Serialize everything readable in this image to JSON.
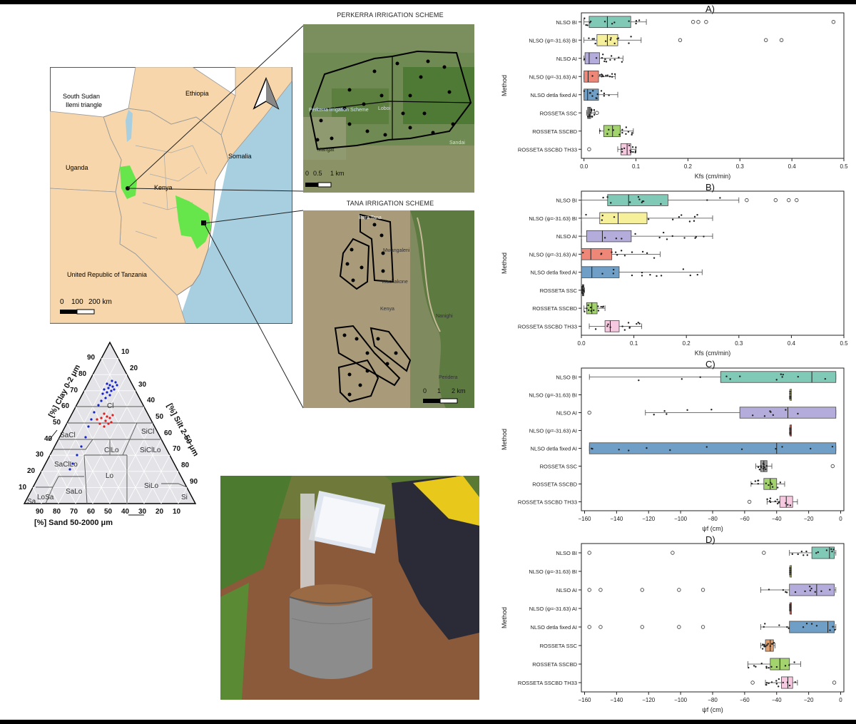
{
  "map": {
    "countries": [
      "South Sudan",
      "Ilemi triangle",
      "Ethiopia",
      "Uganda",
      "Kenya",
      "Somalia",
      "United Republic of Tanzania"
    ],
    "scale": [
      "0",
      "100",
      "200 km"
    ],
    "colors": {
      "land": "#f6d6aa",
      "scheme": "#66e64a",
      "sea": "#a8cfe0",
      "outside": "#ffffff"
    }
  },
  "insets": {
    "perkerra": {
      "title": "PERKERRA IRRIGATION SCHEME",
      "scale": [
        "0",
        "0.5",
        "1 km"
      ],
      "labels": [
        "Perkerra Irrigation Scheme",
        "Marigat",
        "Sandai",
        "Loboi"
      ]
    },
    "tana": {
      "title": "TANA IRRIGATION SCHEME",
      "scale": [
        "0",
        "1",
        "2 km"
      ],
      "labels": [
        "Bura Tana",
        "Mwangaleni",
        "Wachakone",
        "Kenya",
        "Nanighi",
        "Peridera"
      ]
    }
  },
  "triangle": {
    "left_axis": "[%] Clay 0-2 μm",
    "right_axis": "[%] Silt 2-50 μm",
    "bottom_axis": "[%] Sand 50-2000 μm",
    "ticks": [
      "10",
      "20",
      "30",
      "40",
      "50",
      "60",
      "70",
      "80",
      "90"
    ],
    "classes": [
      "Cl",
      "SaCl",
      "SiCl",
      "ClLo",
      "SiClLo",
      "SaClLo",
      "Lo",
      "SaLo",
      "SiLo",
      "LoSa",
      "Sa",
      "Si"
    ],
    "series_colors": {
      "blue": "#1522c9",
      "red": "#e01b1b"
    }
  },
  "chart_data": [
    {
      "type": "box",
      "title": "A)",
      "xlabel": "Kfs (cm/min)",
      "ylabel": "Method",
      "xlim": [
        -0.005,
        0.5
      ],
      "xticks": [
        0.0,
        0.1,
        0.2,
        0.3,
        0.4,
        0.5
      ],
      "xtick_labels": [
        "0.0",
        "0.1",
        "0.2",
        "0.3",
        "0.4",
        "0.5"
      ],
      "categories": [
        "NLSO BI",
        "NLSO  (ψ=-31.63) BI",
        "NLSO  AI",
        "NLSO  (ψ=-31.63) AI",
        "NLSO  detla fixed AI",
        "ROSSETA SSC",
        "ROSSETA SSCBD",
        "ROSSETA SSCBD TH33"
      ],
      "colors": [
        "#7fc9b6",
        "#f7f09a",
        "#b4addb",
        "#ee8777",
        "#6f9fc7",
        "#9a9a9a",
        "#a3d36c",
        "#f6c9e0"
      ],
      "boxes": [
        {
          "wlo": 0.0,
          "q1": 0.01,
          "med": 0.045,
          "q3": 0.09,
          "whi": 0.12,
          "out": [
            0.21,
            0.22,
            0.235,
            0.48
          ]
        },
        {
          "wlo": 0.0,
          "q1": 0.025,
          "med": 0.045,
          "q3": 0.065,
          "whi": 0.11,
          "out": [
            0.185,
            0.35,
            0.38
          ]
        },
        {
          "wlo": 0.0,
          "q1": 0.002,
          "med": 0.01,
          "q3": 0.03,
          "whi": 0.075,
          "out": []
        },
        {
          "wlo": 0.0,
          "q1": 0.0,
          "med": 0.008,
          "q3": 0.028,
          "whi": 0.06,
          "out": []
        },
        {
          "wlo": 0.0,
          "q1": 0.0,
          "med": 0.007,
          "q3": 0.028,
          "whi": 0.065,
          "out": []
        },
        {
          "wlo": 0.005,
          "q1": 0.007,
          "med": 0.01,
          "q3": 0.013,
          "whi": 0.02,
          "out": [
            0.025
          ]
        },
        {
          "wlo": 0.03,
          "q1": 0.038,
          "med": 0.055,
          "q3": 0.07,
          "whi": 0.095,
          "out": []
        },
        {
          "wlo": 0.065,
          "q1": 0.071,
          "med": 0.083,
          "q3": 0.09,
          "whi": 0.1,
          "out": [
            0.01
          ]
        }
      ]
    },
    {
      "type": "box",
      "title": "B)",
      "xlabel": "Kfs (cm/min)",
      "ylabel": "Method",
      "xlim": [
        0.0,
        0.5
      ],
      "xticks": [
        0.0,
        0.1,
        0.2,
        0.3,
        0.4,
        0.5
      ],
      "xtick_labels": [
        "0.0",
        "0.1",
        "0.2",
        "0.3",
        "0.4",
        "0.5"
      ],
      "categories": [
        "NLSO BI",
        "NLSO  (ψ=-31.63) BI",
        "NLSO  AI",
        "NLSO  (ψ=-31.63) AI",
        "NLSO  detla fixed AI",
        "ROSSETA SSC",
        "ROSSETA SSCBD",
        "ROSSETA SSCBD TH33"
      ],
      "colors": [
        "#7fc9b6",
        "#f7f09a",
        "#b4addb",
        "#ee8777",
        "#6f9fc7",
        "#9a9a9a",
        "#a3d36c",
        "#f6c9e0"
      ],
      "boxes": [
        {
          "wlo": 0.0,
          "q1": 0.05,
          "med": 0.09,
          "q3": 0.165,
          "whi": 0.3,
          "out": [
            0.315,
            0.37,
            0.395,
            0.41
          ]
        },
        {
          "wlo": 0.0,
          "q1": 0.035,
          "med": 0.07,
          "q3": 0.125,
          "whi": 0.25,
          "out": []
        },
        {
          "wlo": 0.0,
          "q1": 0.01,
          "med": 0.04,
          "q3": 0.095,
          "whi": 0.25,
          "out": []
        },
        {
          "wlo": 0.0,
          "q1": 0.0,
          "med": 0.018,
          "q3": 0.058,
          "whi": 0.15,
          "out": []
        },
        {
          "wlo": 0.0,
          "q1": 0.0,
          "med": 0.02,
          "q3": 0.072,
          "whi": 0.23,
          "out": []
        },
        {
          "wlo": 0.001,
          "q1": 0.002,
          "med": 0.003,
          "q3": 0.004,
          "whi": 0.006,
          "out": []
        },
        {
          "wlo": 0.005,
          "q1": 0.01,
          "med": 0.02,
          "q3": 0.03,
          "whi": 0.045,
          "out": []
        },
        {
          "wlo": 0.015,
          "q1": 0.045,
          "med": 0.055,
          "q3": 0.072,
          "whi": 0.115,
          "out": []
        }
      ]
    },
    {
      "type": "box",
      "title": "C)",
      "xlabel": "ψf (cm)",
      "ylabel": "Method",
      "xlim": [
        -162,
        2
      ],
      "xticks": [
        -160,
        -140,
        -120,
        -100,
        -80,
        -60,
        -40,
        -20,
        0
      ],
      "xtick_labels": [
        "−160",
        "−140",
        "−120",
        "−100",
        "−80",
        "−60",
        "−40",
        "−20",
        "0"
      ],
      "categories": [
        "NLSO BI",
        "NLSO  (ψ=-31.63) BI",
        "NLSO  AI",
        "NLSO  (ψ=-31.63) AI",
        "NLSO  detla fixed AI",
        "ROSSETA SSC",
        "ROSSETA SSCBD",
        "ROSSETA SSCBD TH33"
      ],
      "colors": [
        "#7fc9b6",
        "#f7f09a",
        "#b4addb",
        "#ee8777",
        "#6f9fc7",
        "#9a9a9a",
        "#a3d36c",
        "#f6c9e0"
      ],
      "boxes": [
        {
          "wlo": -157,
          "q1": -75,
          "med": -18,
          "q3": -3,
          "whi": -3,
          "out": []
        },
        {
          "wlo": -31.6,
          "q1": -31.6,
          "med": -31.6,
          "q3": -31.6,
          "whi": -31.6,
          "out": []
        },
        {
          "wlo": -122,
          "q1": -63,
          "med": -33,
          "q3": -3,
          "whi": -3,
          "out": [
            -157
          ]
        },
        {
          "wlo": -31.6,
          "q1": -31.6,
          "med": -31.6,
          "q3": -31.6,
          "whi": -31.6,
          "out": []
        },
        {
          "wlo": -157,
          "q1": -157,
          "med": -40,
          "q3": -3,
          "whi": -3,
          "out": []
        },
        {
          "wlo": -53,
          "q1": -50,
          "med": -48,
          "q3": -46,
          "whi": -43,
          "out": [
            -5
          ]
        },
        {
          "wlo": -56,
          "q1": -48,
          "med": -44,
          "q3": -40,
          "whi": -35,
          "out": []
        },
        {
          "wlo": -46,
          "q1": -38,
          "med": -34,
          "q3": -30,
          "whi": -27,
          "out": [
            -57
          ]
        }
      ]
    },
    {
      "type": "box",
      "title": "D)",
      "xlabel": "ψf (cm)",
      "ylabel": "Method",
      "xlim": [
        -162,
        2
      ],
      "xticks": [
        -160,
        -140,
        -120,
        -100,
        -80,
        -60,
        -40,
        -20,
        0
      ],
      "xtick_labels": [
        "−160",
        "−140",
        "−120",
        "−100",
        "−80",
        "−60",
        "−40",
        "−20",
        "0"
      ],
      "categories": [
        "NLSO BI",
        "NLSO  (ψ=-31.63) BI",
        "NLSO  AI",
        "NLSO  (ψ=-31.63) AI",
        "NLSO  detla fixed AI",
        "ROSSETA SSC",
        "ROSSETA SSCBD",
        "ROSSETA SSCBD TH33"
      ],
      "colors": [
        "#7fc9b6",
        "#f7f09a",
        "#b4addb",
        "#ee8777",
        "#6f9fc7",
        "#e0a070",
        "#a3d36c",
        "#f6c9e0"
      ],
      "boxes": [
        {
          "wlo": -32,
          "q1": -18,
          "med": -7,
          "q3": -4,
          "whi": -3,
          "out": [
            -157,
            -105,
            -48
          ]
        },
        {
          "wlo": -31.6,
          "q1": -31.6,
          "med": -31.6,
          "q3": -31.6,
          "whi": -31.6,
          "out": []
        },
        {
          "wlo": -50,
          "q1": -32,
          "med": -15,
          "q3": -4,
          "whi": -3,
          "out": [
            -157,
            -150,
            -124,
            -101,
            -86
          ]
        },
        {
          "wlo": -31.6,
          "q1": -31.6,
          "med": -31.6,
          "q3": -31.6,
          "whi": -31.6,
          "out": []
        },
        {
          "wlo": -50,
          "q1": -32,
          "med": -8,
          "q3": -4,
          "whi": -3,
          "out": [
            -157,
            -150,
            -124,
            -101,
            -86
          ]
        },
        {
          "wlo": -50,
          "q1": -47,
          "med": -44,
          "q3": -42,
          "whi": -41,
          "out": []
        },
        {
          "wlo": -58,
          "q1": -44,
          "med": -38,
          "q3": -32,
          "whi": -25,
          "out": []
        },
        {
          "wlo": -47,
          "q1": -37,
          "med": -33,
          "q3": -30,
          "whi": -27,
          "out": [
            -55,
            -4
          ]
        }
      ]
    }
  ]
}
